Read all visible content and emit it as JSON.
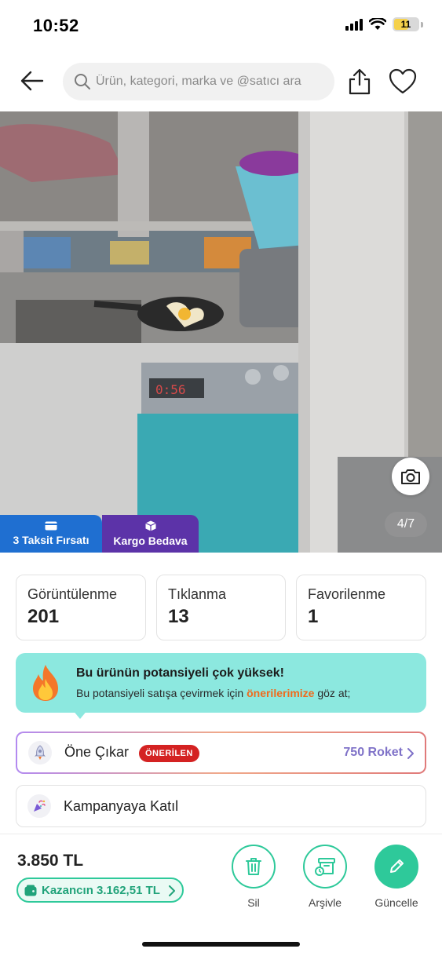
{
  "status_bar": {
    "time": "10:52",
    "battery": "11"
  },
  "search": {
    "placeholder": "Ürün, kategori, marka ve @satıcı ara"
  },
  "gallery": {
    "counter": "4/7"
  },
  "tags": {
    "taksit": "3 Taksit Fırsatı",
    "kargo": "Kargo Bedava"
  },
  "stats": [
    {
      "label": "Görüntülenme",
      "value": "201"
    },
    {
      "label": "Tıklanma",
      "value": "13"
    },
    {
      "label": "Favorilenme",
      "value": "1"
    }
  ],
  "potential": {
    "title": "Bu ürünün potansiyeli çok yüksek!",
    "text_before": "Bu potansiyeli satışa çevirmek için ",
    "link": "önerilerimize",
    "text_after": " göz at;"
  },
  "boost": {
    "label": "Öne Çıkar",
    "badge": "ÖNERİLEN",
    "price": "750 Roket"
  },
  "campaign": {
    "label": "Kampanyaya Katıl"
  },
  "bottom": {
    "price": "3.850 TL",
    "earnings": "Kazancın 3.162,51 TL",
    "actions": {
      "delete": "Sil",
      "archive": "Arşivle",
      "update": "Güncelle"
    }
  },
  "colors": {
    "accent": "#2ec99a",
    "taksit_tag": "#1f6fd1",
    "kargo_tag": "#5c33a8",
    "banner": "#8ce8df",
    "badge": "#d42222",
    "link": "#f06a1c"
  }
}
